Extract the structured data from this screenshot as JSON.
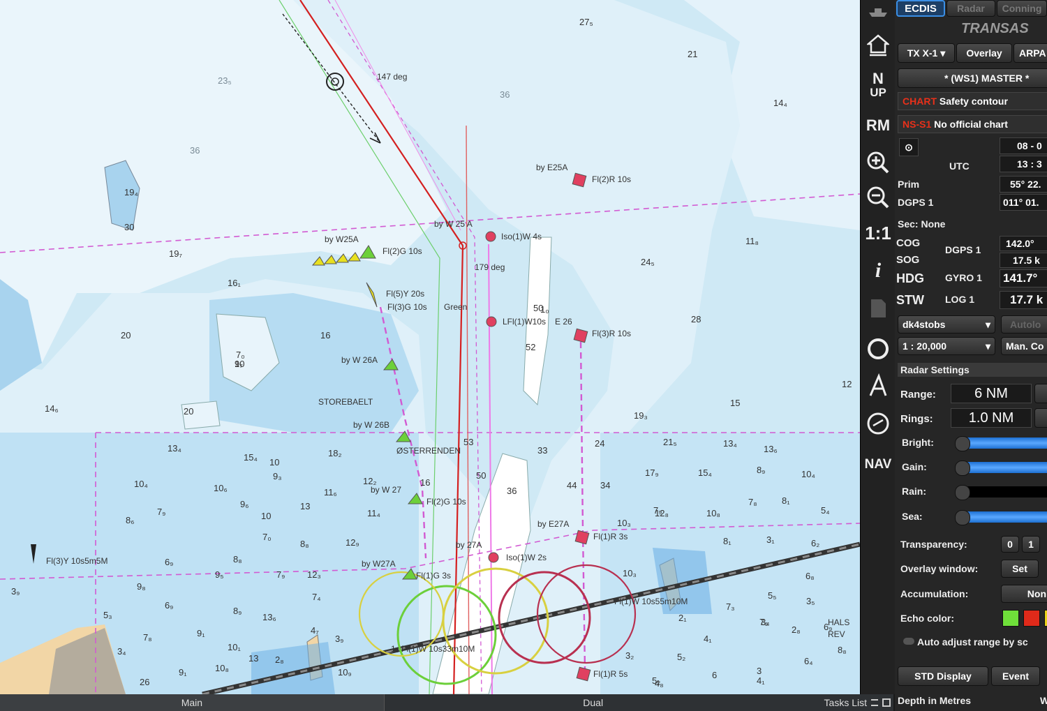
{
  "chart": {
    "soundings": [
      "27₅",
      "21",
      "23₅",
      "36",
      "14₄",
      "36",
      "19₄",
      "30",
      "19₇",
      "11₈",
      "24₅",
      "16₁",
      "20",
      "16",
      "28",
      "7₀",
      "10",
      "52",
      "12",
      "14₆",
      "20",
      "15",
      "19₃",
      "21₅",
      "13₄",
      "13₆",
      "13₄",
      "15₄",
      "10",
      "18₂",
      "9₃",
      "12₂",
      "16",
      "17₉",
      "15₄",
      "8₉",
      "10₄",
      "10₄",
      "10₆",
      "11₆",
      "9₆",
      "13",
      "11₄",
      "7₉",
      "8₁",
      "7₈",
      "5₄",
      "7₉",
      "10",
      "12₈",
      "10₈",
      "12₉",
      "10₃",
      "8₆",
      "7₀",
      "8₈",
      "8₁",
      "3₁",
      "6₂",
      "3₉",
      "6₉",
      "8₈",
      "9₅",
      "7₉",
      "12₃",
      "7₄",
      "5₅",
      "3₅",
      "9₈",
      "10₃",
      "6₈",
      "5₃",
      "6₉",
      "8₉",
      "13₆",
      "2₁",
      "7₃",
      "3₄",
      "7₈",
      "9₁",
      "10₁",
      "2₈",
      "6₉",
      "3₄",
      "13",
      "2₈",
      "4₇",
      "3₉",
      "4₁",
      "2₉",
      "7₆",
      "5₂",
      "6₄",
      "3₂",
      "8₈",
      "9₁",
      "10₈",
      "10₉",
      "5₂",
      "4₈",
      "6",
      "3",
      "4₁",
      "26",
      "24",
      "34",
      "44",
      "33",
      "53",
      "36",
      "50",
      "50",
      "1₀",
      "9₇"
    ],
    "labels": {
      "course_deg_1": "147 deg",
      "course_deg_2": "179 deg",
      "buoy_e25a": "by E25A",
      "buoy_e25a_light": "Fl(2)R 10s",
      "buoy_w25a": "by W25A",
      "buoy_w25a_light": "Fl(2)G 10s",
      "buoy_w25": "by W 25 A",
      "iso_light": "Iso(1)W 4s",
      "fl5y": "Fl(5)Y 20s",
      "fl3g": "Fl(3)G 10s",
      "green_label": "Green",
      "lfl": "LFl(1)W10s",
      "e26": "E 26",
      "fl3r": "Fl(3)R 10s",
      "w26a": "by W 26A",
      "storebaelt": "STOREBAELT",
      "w26b": "by W 26B",
      "osterrenden": "ØSTERRENDEN",
      "w27": "by W 27",
      "fl2g": "Fl(2)G 10s",
      "e27a": "by E27A",
      "fl1r3s": "Fl(1)R 3s",
      "by27a": "by 27A",
      "iso2s": "Iso(1)W 2s",
      "w27a": "by W27A",
      "fl1g": "Fl(1)G 3s",
      "fl3y": "Fl(3)Y 10s5m5M",
      "fl1r5s": "Fl(1)R 5s",
      "hals": "HALS",
      "rev": "REV",
      "bridge_label": "Fl(1)W 10s55m10M",
      "bridge_label2": "1₀ Fl(1)W 10s33m10M"
    }
  },
  "bottom_bar": {
    "tabs": [
      "Main",
      "Dual"
    ],
    "tasks_label": "Tasks List"
  },
  "icon_bar": {
    "north_up_n": "N",
    "north_up_up": "UP",
    "rm": "RM",
    "scale_1_1": "1:1",
    "info": "i",
    "nav": "NAV"
  },
  "panel": {
    "tabs": [
      "ECDIS",
      "Radar",
      "Conning"
    ],
    "brand": "TRANSAS",
    "tx_select": "TX X-1",
    "overlay_btn": "Overlay",
    "arpa_btn": "ARPA",
    "master_btn": "* (WS1) MASTER *",
    "chart_alert_tag": "CHART",
    "chart_alert_text": "Safety contour",
    "ns_alert_tag": "NS-S1",
    "ns_alert_text": "No official chart",
    "date": "08 - 0",
    "utc_label": "UTC",
    "time": "13 : 3",
    "prim_label": "Prim",
    "dgps1_label": "DGPS 1",
    "lat": "55° 22.",
    "lon": "011° 01.",
    "sec_label": "Sec: None",
    "cog_label": "COG",
    "sog_label": "SOG",
    "dgps1_src": "DGPS 1",
    "cog_val": "142.0°",
    "sog_val": "17.5 k",
    "hdg_label": "HDG",
    "gyro_src": "GYRO 1",
    "hdg_val": "141.7°",
    "stw_label": "STW",
    "log_src": "LOG 1",
    "stw_val": "17.7 k",
    "route_select": "dk4stobs",
    "autoload": "Autolo",
    "scale_select": "1 : 20,000",
    "man_btn": "Man. Co",
    "radar_settings": "Radar Settings",
    "range_label": "Range:",
    "range_val": "6 NM",
    "rings_label": "Rings:",
    "rings_val": "1.0 NM",
    "bright_label": "Bright:",
    "gain_label": "Gain:",
    "rain_label": "Rain:",
    "sea_label": "Sea:",
    "transparency_label": "Transparency:",
    "transp_0": "0",
    "transp_1": "1",
    "overlay_window_label": "Overlay window:",
    "set_btn": "Set",
    "accumulation_label": "Accumulation:",
    "accum_val": "Non",
    "echo_color_label": "Echo color:",
    "echo_colors": [
      "#6fe03a",
      "#e02a1a",
      "#e8d21a"
    ],
    "auto_adjust_label": "Auto adjust range by sc",
    "std_display_btn": "STD Display",
    "event_btn": "Event",
    "depth_label": "Depth in Metres",
    "w_label": "W"
  }
}
